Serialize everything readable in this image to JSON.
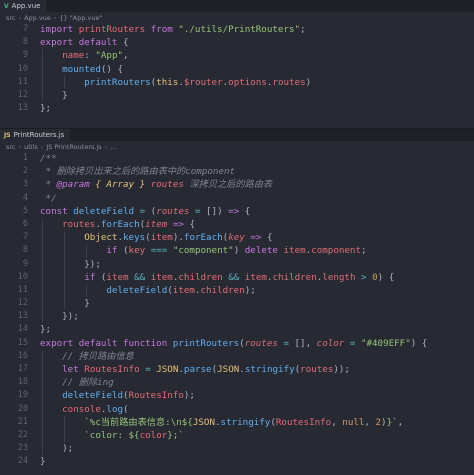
{
  "top_pane": {
    "tab_icon": "V",
    "tab_label": "App.vue",
    "breadcrumb": [
      "src",
      "App.vue",
      "{} \"App.vue\""
    ],
    "first_line_no": 7,
    "lines": [
      [
        [
          "kw",
          "import "
        ],
        [
          "var",
          "printRouters"
        ],
        [
          "kw",
          " from "
        ],
        [
          "str",
          "\"./utils/PrintRouters\""
        ],
        [
          "pun",
          ";"
        ]
      ],
      [
        [
          "kw",
          "export default "
        ],
        [
          "pun",
          "{"
        ]
      ],
      [
        [
          "pun",
          "    "
        ],
        [
          "var",
          "name"
        ],
        [
          "pun",
          ": "
        ],
        [
          "str",
          "\"App\""
        ],
        [
          "pun",
          ","
        ]
      ],
      [
        [
          "pun",
          "    "
        ],
        [
          "fn",
          "mounted"
        ],
        [
          "pun",
          "() {"
        ]
      ],
      [
        [
          "pun",
          "        "
        ],
        [
          "fn",
          "printRouters"
        ],
        [
          "pun",
          "("
        ],
        [
          "prop",
          "this"
        ],
        [
          "pun",
          "."
        ],
        [
          "var",
          "$router"
        ],
        [
          "pun",
          "."
        ],
        [
          "var",
          "options"
        ],
        [
          "pun",
          "."
        ],
        [
          "var",
          "routes"
        ],
        [
          "pun",
          ")"
        ]
      ],
      [
        [
          "pun",
          "    }"
        ]
      ],
      [
        [
          "pun",
          "};"
        ]
      ]
    ]
  },
  "bottom_pane": {
    "tab_icon": "JS",
    "tab_label": "PrintRouters.js",
    "breadcrumb": [
      "src",
      "utils",
      "JS PrintRouters.js",
      "..."
    ],
    "first_line_no": 1,
    "lines": [
      [
        [
          "com",
          "/**"
        ]
      ],
      [
        [
          "com",
          " * 删除拷贝出来之后的路由表中的component"
        ]
      ],
      [
        [
          "com",
          " * "
        ],
        [
          "ckw",
          "@param"
        ],
        [
          "com",
          " "
        ],
        [
          "ctype",
          "{ Array }"
        ],
        [
          "com",
          " "
        ],
        [
          "cvar",
          "routes"
        ],
        [
          "com",
          " 深拷贝之后的路由表"
        ]
      ],
      [
        [
          "com",
          " */"
        ]
      ],
      [
        [
          "kw",
          "const "
        ],
        [
          "fn",
          "deleteField"
        ],
        [
          "op",
          " = "
        ],
        [
          "pun",
          "("
        ],
        [
          "param",
          "routes"
        ],
        [
          "op",
          " = "
        ],
        [
          "pun",
          "[]) "
        ],
        [
          "kw",
          "=>"
        ],
        [
          "pun",
          " {"
        ]
      ],
      [
        [
          "pun",
          "    "
        ],
        [
          "var",
          "routes"
        ],
        [
          "pun",
          "."
        ],
        [
          "fn",
          "forEach"
        ],
        [
          "pun",
          "("
        ],
        [
          "param",
          "item"
        ],
        [
          "kw",
          " =>"
        ],
        [
          "pun",
          " {"
        ]
      ],
      [
        [
          "pun",
          "        "
        ],
        [
          "prop",
          "Object"
        ],
        [
          "pun",
          "."
        ],
        [
          "fn",
          "keys"
        ],
        [
          "pun",
          "("
        ],
        [
          "var",
          "item"
        ],
        [
          "pun",
          ")."
        ],
        [
          "fn",
          "forEach"
        ],
        [
          "pun",
          "("
        ],
        [
          "param",
          "key"
        ],
        [
          "kw",
          " =>"
        ],
        [
          "pun",
          " {"
        ]
      ],
      [
        [
          "pun",
          "            "
        ],
        [
          "kw",
          "if"
        ],
        [
          "pun",
          " ("
        ],
        [
          "var",
          "key"
        ],
        [
          "op",
          " === "
        ],
        [
          "str",
          "\"component\""
        ],
        [
          "pun",
          ") "
        ],
        [
          "kw",
          "delete"
        ],
        [
          "pun",
          " "
        ],
        [
          "var",
          "item"
        ],
        [
          "pun",
          "."
        ],
        [
          "var",
          "component"
        ],
        [
          "pun",
          ";"
        ]
      ],
      [
        [
          "pun",
          "        });"
        ]
      ],
      [
        [
          "pun",
          "        "
        ],
        [
          "kw",
          "if"
        ],
        [
          "pun",
          " ("
        ],
        [
          "var",
          "item"
        ],
        [
          "op",
          " && "
        ],
        [
          "var",
          "item"
        ],
        [
          "pun",
          "."
        ],
        [
          "var",
          "children"
        ],
        [
          "op",
          " && "
        ],
        [
          "var",
          "item"
        ],
        [
          "pun",
          "."
        ],
        [
          "var",
          "children"
        ],
        [
          "pun",
          "."
        ],
        [
          "var",
          "length"
        ],
        [
          "op",
          " > "
        ],
        [
          "num",
          "0"
        ],
        [
          "pun",
          ") {"
        ]
      ],
      [
        [
          "pun",
          "            "
        ],
        [
          "fn",
          "deleteField"
        ],
        [
          "pun",
          "("
        ],
        [
          "var",
          "item"
        ],
        [
          "pun",
          "."
        ],
        [
          "var",
          "children"
        ],
        [
          "pun",
          ");"
        ]
      ],
      [
        [
          "pun",
          "        }"
        ]
      ],
      [
        [
          "pun",
          "    });"
        ]
      ],
      [
        [
          "pun",
          "};"
        ]
      ],
      [
        [
          "kw",
          "export default function "
        ],
        [
          "fn",
          "printRouters"
        ],
        [
          "pun",
          "("
        ],
        [
          "param",
          "routes"
        ],
        [
          "op",
          " = "
        ],
        [
          "pun",
          "[], "
        ],
        [
          "param",
          "color"
        ],
        [
          "op",
          " = "
        ],
        [
          "str",
          "\"#409EFF\""
        ],
        [
          "pun",
          ") {"
        ]
      ],
      [
        [
          "pun",
          "    "
        ],
        [
          "com",
          "// 拷贝路由信息"
        ]
      ],
      [
        [
          "pun",
          "    "
        ],
        [
          "kw",
          "let "
        ],
        [
          "var",
          "RoutesInfo"
        ],
        [
          "op",
          " = "
        ],
        [
          "prop",
          "JSON"
        ],
        [
          "pun",
          "."
        ],
        [
          "fn",
          "parse"
        ],
        [
          "pun",
          "("
        ],
        [
          "prop",
          "JSON"
        ],
        [
          "pun",
          "."
        ],
        [
          "fn",
          "stringify"
        ],
        [
          "pun",
          "("
        ],
        [
          "var",
          "routes"
        ],
        [
          "pun",
          "));"
        ]
      ],
      [
        [
          "pun",
          "    "
        ],
        [
          "com",
          "// 删除ing"
        ]
      ],
      [
        [
          "pun",
          "    "
        ],
        [
          "fn",
          "deleteField"
        ],
        [
          "pun",
          "("
        ],
        [
          "var",
          "RoutesInfo"
        ],
        [
          "pun",
          ");"
        ]
      ],
      [
        [
          "pun",
          "    "
        ],
        [
          "var",
          "console"
        ],
        [
          "pun",
          "."
        ],
        [
          "fn",
          "log"
        ],
        [
          "pun",
          "("
        ]
      ],
      [
        [
          "pun",
          "        "
        ],
        [
          "str",
          "`%c当前路由表信息:\\n${"
        ],
        [
          "prop",
          "JSON"
        ],
        [
          "pun",
          "."
        ],
        [
          "fn",
          "stringify"
        ],
        [
          "pun",
          "("
        ],
        [
          "var",
          "RoutesInfo"
        ],
        [
          "pun",
          ", "
        ],
        [
          "num",
          "null"
        ],
        [
          "pun",
          ", "
        ],
        [
          "num",
          "2"
        ],
        [
          "pun",
          ")"
        ],
        [
          "str",
          "}`"
        ],
        [
          "pun",
          ","
        ]
      ],
      [
        [
          "pun",
          "        "
        ],
        [
          "str",
          "`color: ${"
        ],
        [
          "var",
          "color"
        ],
        [
          "str",
          "};`"
        ]
      ],
      [
        [
          "pun",
          "    );"
        ]
      ],
      [
        [
          "pun",
          "}"
        ]
      ]
    ]
  }
}
